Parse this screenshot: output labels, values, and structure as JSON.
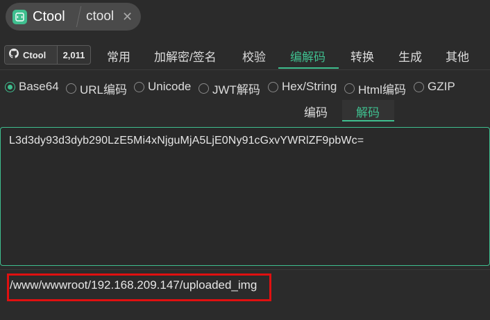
{
  "app": {
    "name": "Ctool",
    "breadcrumb": "ctool",
    "close_icon": "close-icon",
    "accent_color": "#3fbf8f"
  },
  "github_badge": {
    "label": "Ctool",
    "count": "2,011",
    "icon": "github-icon"
  },
  "nav": {
    "tabs": [
      "常用",
      "加解密/签名",
      "校验",
      "编解码",
      "转换",
      "生成",
      "其他"
    ],
    "active": "编解码"
  },
  "encoding_options": {
    "items": [
      "Base64",
      "URL编码",
      "Unicode",
      "JWT解码",
      "Hex/String",
      "Html编码",
      "GZIP"
    ],
    "selected": "Base64"
  },
  "subtabs": {
    "items": [
      "编码",
      "解码"
    ],
    "active": "解码"
  },
  "input": {
    "value": "L3d3dy93d3dyb290LzE5Mi4xNjguMjA5LjE0Ny91cGxvYWRlZF9pbWc="
  },
  "output": {
    "value": "/www/wwwroot/192.168.209.147/uploaded_img",
    "highlight_color": "#e01010"
  }
}
